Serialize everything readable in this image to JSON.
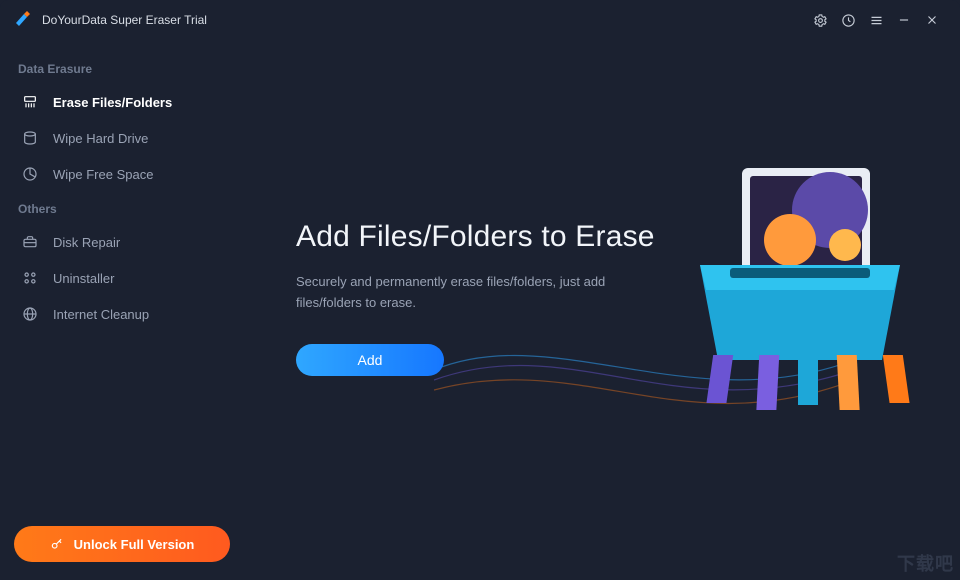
{
  "window": {
    "title": "DoYourData Super Eraser Trial"
  },
  "titlebar_icons": {
    "settings": "settings-icon",
    "history": "history-icon",
    "menu": "menu-icon",
    "minimize": "minimize-icon",
    "close": "close-icon"
  },
  "sidebar": {
    "section1_label": "Data Erasure",
    "section2_label": "Others",
    "items1": [
      {
        "label": "Erase Files/Folders",
        "icon": "shred-icon",
        "active": true
      },
      {
        "label": "Wipe Hard Drive",
        "icon": "drive-icon",
        "active": false
      },
      {
        "label": "Wipe Free Space",
        "icon": "pie-icon",
        "active": false
      }
    ],
    "items2": [
      {
        "label": "Disk Repair",
        "icon": "toolbox-icon"
      },
      {
        "label": "Uninstaller",
        "icon": "grid-icon"
      },
      {
        "label": "Internet Cleanup",
        "icon": "globe-icon"
      }
    ],
    "unlock_label": "Unlock Full Version"
  },
  "main": {
    "heading": "Add Files/Folders to Erase",
    "desc": "Securely and permanently erase files/folders, just add files/folders to erase.",
    "add_label": "Add"
  },
  "watermark": "下载吧",
  "colors": {
    "bg": "#1b2130",
    "accent_blue": "#1677ff",
    "accent_orange": "#ff5a1f"
  }
}
